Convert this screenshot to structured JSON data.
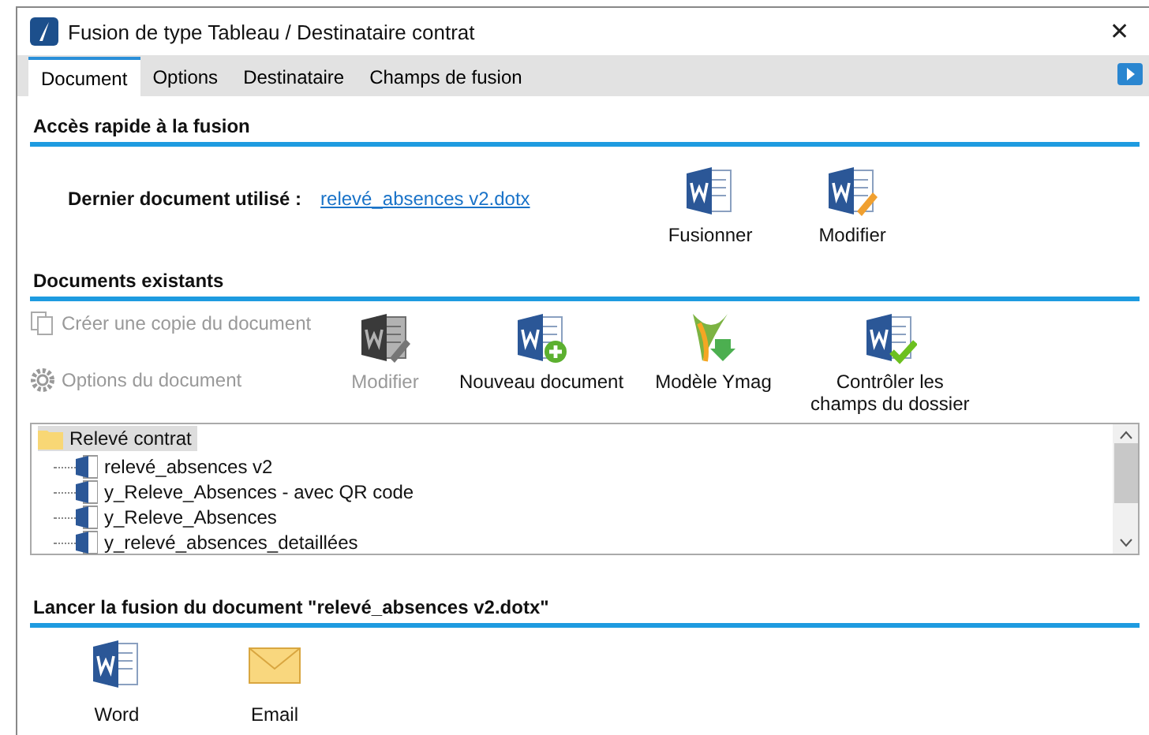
{
  "window": {
    "title": "Fusion de type Tableau / Destinataire contrat",
    "close": "✕"
  },
  "tabs": [
    {
      "label": "Document",
      "selected": true
    },
    {
      "label": "Options",
      "selected": false
    },
    {
      "label": "Destinataire",
      "selected": false
    },
    {
      "label": "Champs de fusion",
      "selected": false
    }
  ],
  "quick_access": {
    "heading": "Accès rapide à la fusion",
    "last_label": "Dernier document utilisé :",
    "last_link": "relevé_absences v2.dotx",
    "buttons": [
      {
        "label": "Fusionner",
        "kind": "word",
        "disabled": false
      },
      {
        "label": "Modifier",
        "kind": "word-edit",
        "disabled": false
      }
    ]
  },
  "existing": {
    "heading": "Documents existants",
    "side_actions": [
      {
        "label": "Créer une copie du document",
        "kind": "copy",
        "disabled": true
      },
      {
        "label": "Options du document",
        "kind": "gear",
        "disabled": true
      }
    ],
    "buttons": [
      {
        "label": "Modifier",
        "kind": "word-edit",
        "disabled": true
      },
      {
        "label": "Nouveau document",
        "kind": "word-new",
        "disabled": false
      },
      {
        "label": "Modèle Ymag",
        "kind": "ymag",
        "disabled": false
      },
      {
        "label": "Contrôler les champs du dossier",
        "kind": "word-check",
        "disabled": false
      }
    ],
    "tree": [
      {
        "label": "Relevé contrat",
        "selected": true,
        "children": [
          {
            "label": "relevé_absences v2",
            "selected": false
          },
          {
            "label": "y_Releve_Absences - avec QR code",
            "selected": false
          },
          {
            "label": "y_Releve_Absences",
            "selected": false
          },
          {
            "label": "y_relevé_absences_detaillées",
            "selected": false
          }
        ]
      }
    ]
  },
  "launch": {
    "heading": "Lancer la fusion du document \"relevé_absences v2.dotx\"",
    "buttons": [
      {
        "label": "Word",
        "kind": "word"
      },
      {
        "label": "Email",
        "kind": "email"
      }
    ]
  }
}
